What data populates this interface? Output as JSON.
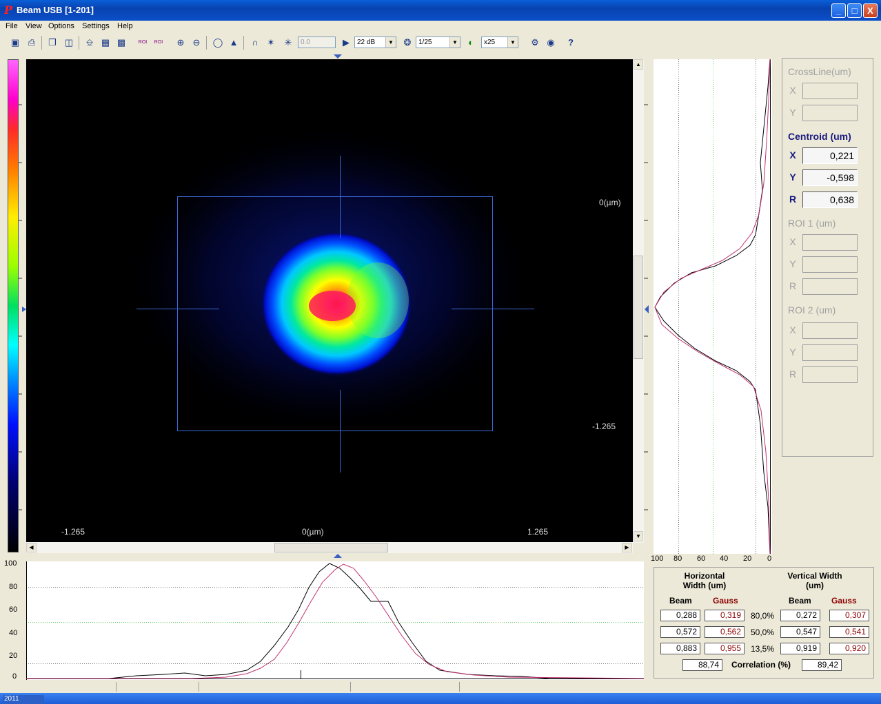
{
  "window": {
    "title": "Beam USB  [1-201]",
    "minimize": "_",
    "maximize": "□",
    "close": "X"
  },
  "menu": [
    "File",
    "View",
    "Options",
    "Settings",
    "Help"
  ],
  "toolbar": {
    "offset_value": "0.0",
    "gain": "22 dB",
    "exposure": "1/25",
    "averaging": "x25",
    "help": "?"
  },
  "image": {
    "x_min": "-1.265",
    "x_mid": "0(µm)",
    "x_max": "1.265",
    "y_mid": "0(µm)",
    "y_min": "-1.265"
  },
  "vprofile": {
    "ticks": [
      "100",
      "80",
      "60",
      "40",
      "20",
      "0"
    ]
  },
  "hprofile": {
    "ticks": [
      "100",
      "80",
      "60",
      "40",
      "20",
      "0"
    ]
  },
  "side": {
    "crossline": {
      "title": "CrossLine(um)",
      "x_label": "X",
      "y_label": "Y",
      "x": "",
      "y": ""
    },
    "centroid": {
      "title": "Centroid (um)",
      "x_label": "X",
      "y_label": "Y",
      "r_label": "R",
      "x": "0,221",
      "y": "-0,598",
      "r": "0,638"
    },
    "roi1": {
      "title": "ROI 1 (um)",
      "x_label": "X",
      "y_label": "Y",
      "r_label": "R"
    },
    "roi2": {
      "title": "ROI 2 (um)",
      "x_label": "X",
      "y_label": "Y",
      "r_label": "R"
    }
  },
  "widths": {
    "horizontal_title": "Horizontal Width  (um)",
    "vertical_title": "Vertical Width  (um)",
    "beam_label": "Beam",
    "gauss_label": "Gauss",
    "rows": [
      {
        "level": "80,0%",
        "h_beam": "0,288",
        "h_gauss": "0,319",
        "v_beam": "0,272",
        "v_gauss": "0,307"
      },
      {
        "level": "50,0%",
        "h_beam": "0,572",
        "h_gauss": "0,562",
        "v_beam": "0,547",
        "v_gauss": "0,541"
      },
      {
        "level": "13,5%",
        "h_beam": "0,883",
        "h_gauss": "0,955",
        "v_beam": "0,919",
        "v_gauss": "0,920"
      }
    ],
    "correlation_label": "Correlation (%)",
    "correlation_h": "88,74",
    "correlation_v": "89,42"
  },
  "taskbar": {
    "item": "2011"
  },
  "colors": {
    "title_bar": "#0a5fd8",
    "centroid_text": "#1a1a80",
    "gauss_text": "#8b0000",
    "profile_fit": "#c03070"
  }
}
